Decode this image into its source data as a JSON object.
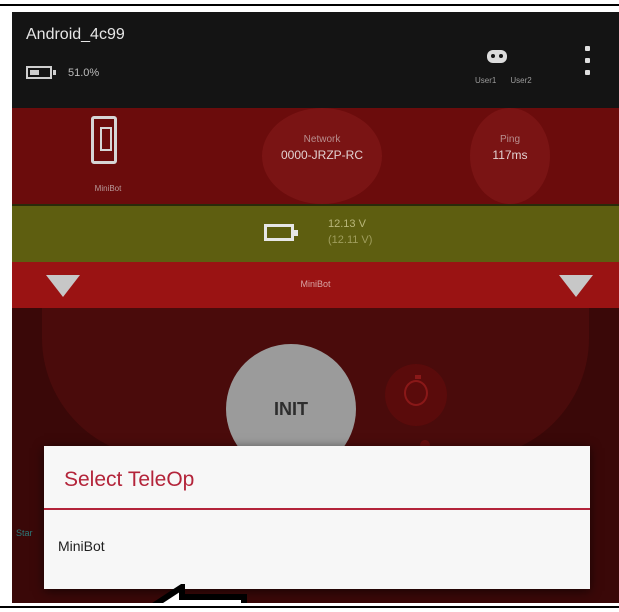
{
  "header": {
    "device_name": "Android_4c99",
    "battery_percent": "51.0%",
    "battery_level": 0.51,
    "users": [
      "User1",
      "User2"
    ]
  },
  "status": {
    "robot_label": "MiniBot",
    "network_label": "Network",
    "network_value": "0000-JRZP-RC",
    "ping_label": "Ping",
    "ping_value": "117ms"
  },
  "voltage": {
    "value": "12.13 V",
    "sub": "(12.11 V)"
  },
  "opmode": {
    "name": "MiniBot"
  },
  "controls": {
    "init_label": "INIT",
    "left_edge_text": "Star"
  },
  "dialog": {
    "title": "Select TeleOp",
    "options": [
      "MiniBot"
    ]
  },
  "colors": {
    "dialog_accent": "#b3243a",
    "status_band": "#6b0c0c",
    "voltage_band": "#5e5e10",
    "opmode_band": "#9a1313"
  },
  "icons": [
    "battery-icon",
    "gamepad-icon",
    "overflow-menu-icon",
    "robot-icon",
    "voltage-battery-icon",
    "timer-icon",
    "arrow-left-icon",
    "dropdown-triangle-icon"
  ]
}
